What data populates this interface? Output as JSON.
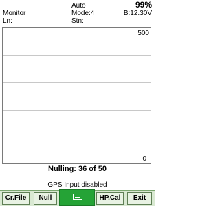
{
  "status": {
    "app_name": "Monitor",
    "line_label": "Ln:",
    "mode_top": "Auto",
    "mode": "Mode:4",
    "station_label": "Stn:",
    "battery_percent": "99%",
    "battery_voltage": "B:12.30V"
  },
  "plot": {
    "y_max_label": "500",
    "y_min_label": "0"
  },
  "nulling": {
    "text": "Nulling:  36 of 50"
  },
  "gps": {
    "text": "GPS  Input  disabled"
  },
  "menu": {
    "cr_file": "Cr.File",
    "null": "Null",
    "hp_cal": "HP.Cal",
    "exit": "Exit",
    "keyboard_icon": "keyboard-icon"
  }
}
